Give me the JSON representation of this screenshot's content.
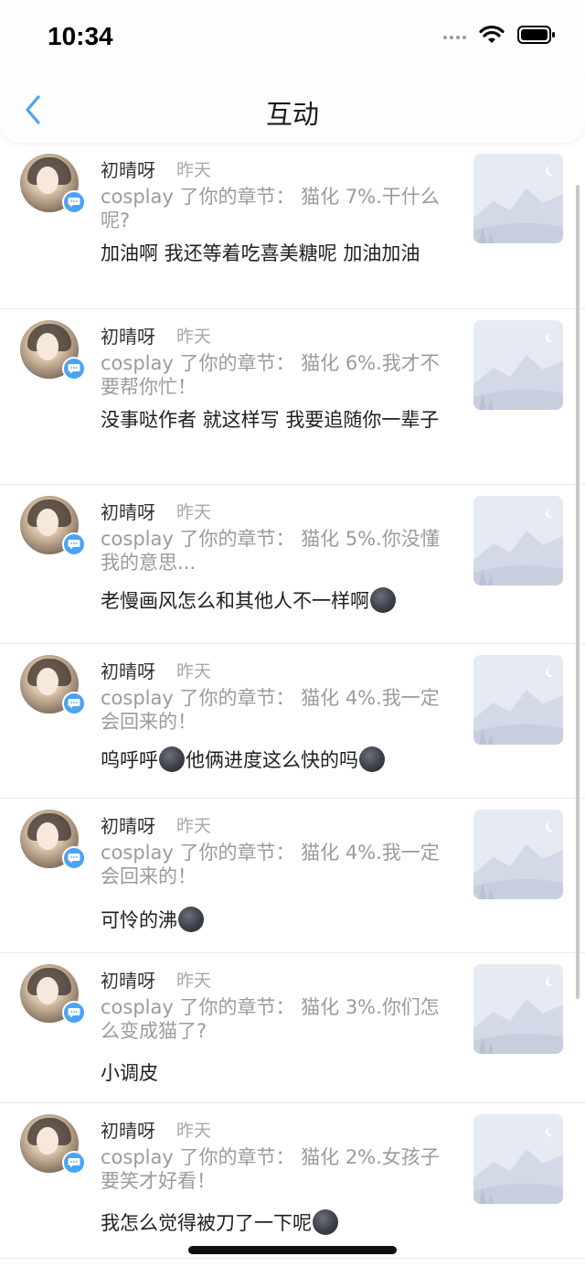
{
  "status_bar": {
    "time": "10:34"
  },
  "nav": {
    "title": "互动"
  },
  "items": [
    {
      "username": "初晴呀",
      "time": "昨天",
      "quote": "cosplay 了你的章节：  猫化 7%.干什么呢?",
      "comment": [
        "加油啊 我还等着吃喜美糖呢 加油加油"
      ]
    },
    {
      "username": "初晴呀",
      "time": "昨天",
      "quote": "cosplay 了你的章节：  猫化 6%.我才不要帮你忙！",
      "comment": [
        "没事哒作者 就这样写 我要追随你一辈子"
      ]
    },
    {
      "username": "初晴呀",
      "time": "昨天",
      "quote": "cosplay 了你的章节：  猫化 5%.你没懂我的意思...",
      "comment": [
        "老慢画风怎么和其他人不一样啊",
        "moon"
      ]
    },
    {
      "username": "初晴呀",
      "time": "昨天",
      "quote": "cosplay 了你的章节：  猫化 4%.我一定会回来的！",
      "comment": [
        "呜呼呼",
        "moon",
        "他俩进度这么快的吗",
        "moon"
      ]
    },
    {
      "username": "初晴呀",
      "time": "昨天",
      "quote": "cosplay 了你的章节：  猫化 4%.我一定会回来的！",
      "comment": [
        "可怜的沸",
        "moon"
      ]
    },
    {
      "username": "初晴呀",
      "time": "昨天",
      "quote": "cosplay 了你的章节：  猫化 3%.你们怎么变成猫了?",
      "comment": [
        "小调皮"
      ]
    },
    {
      "username": "初晴呀",
      "time": "昨天",
      "quote": "cosplay 了你的章节：  猫化 2%.女孩子要笑才好看！",
      "comment": [
        "我怎么觉得被刀了一下呢",
        "moon"
      ]
    }
  ],
  "colors": {
    "accent": "#4aa3f5",
    "muted": "#9b9b9b"
  },
  "icons": {
    "back": "chevron-left-icon",
    "badge": "comment-bubble-icon",
    "emoji": "new-moon-face-icon",
    "thumbnail": "image-placeholder-icon"
  }
}
